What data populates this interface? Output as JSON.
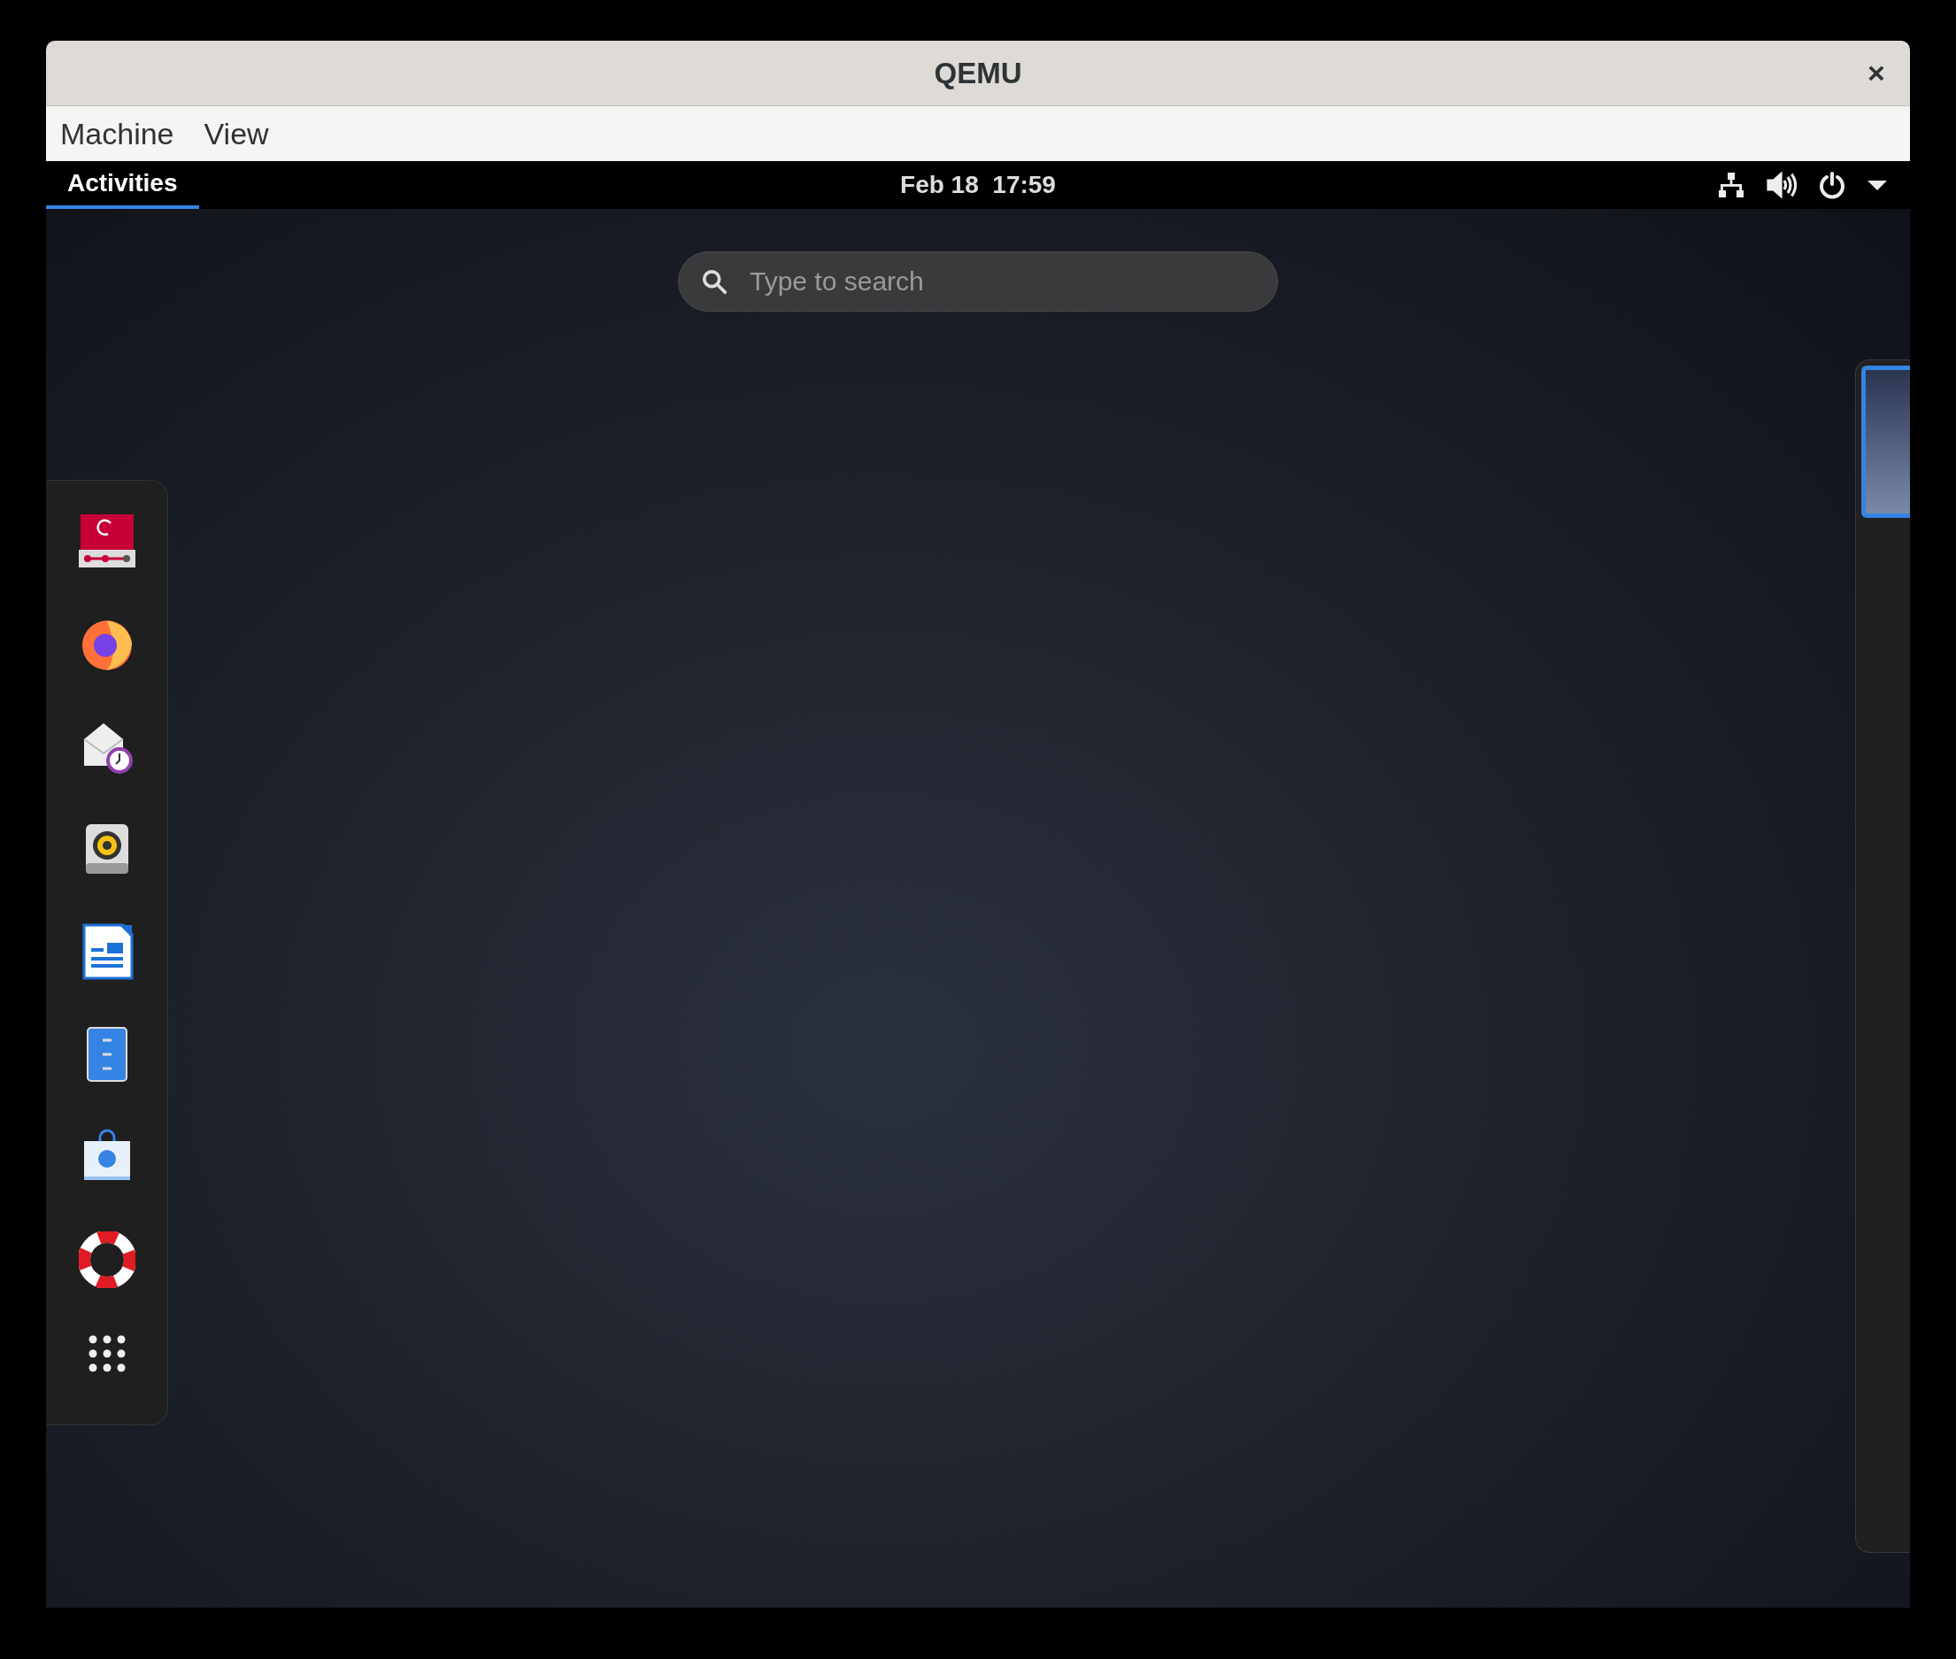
{
  "window": {
    "title": "QEMU",
    "close": "×"
  },
  "menu": [
    {
      "label": "Machine"
    },
    {
      "label": "View"
    }
  ],
  "top_bar": {
    "activities": {
      "label": "Activities",
      "selected": true
    },
    "clock": "Feb 18  17:59"
  },
  "search": {
    "placeholder": "Type to search"
  },
  "workspaces": [
    {
      "selected": true
    }
  ]
}
